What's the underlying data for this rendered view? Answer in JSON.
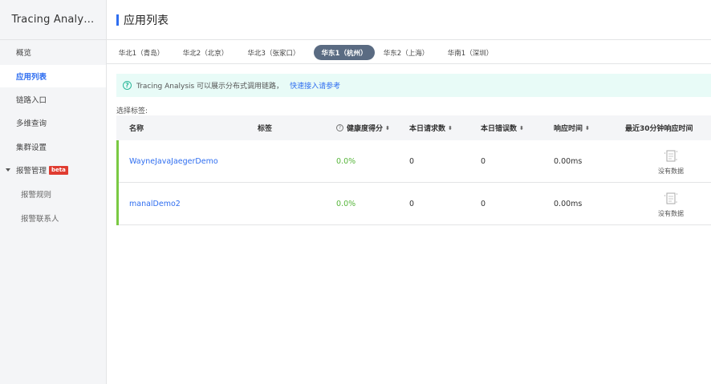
{
  "sidebar": {
    "brand": "Tracing Analy…",
    "items": [
      {
        "label": "概览"
      },
      {
        "label": "应用列表"
      },
      {
        "label": "链路入口"
      },
      {
        "label": "多维查询"
      },
      {
        "label": "集群设置"
      },
      {
        "label": "报警管理",
        "badge": "beta"
      },
      {
        "label": "报警规则"
      },
      {
        "label": "报警联系人"
      }
    ]
  },
  "header": {
    "title": "应用列表"
  },
  "regions": [
    {
      "label": "华北1（青岛）"
    },
    {
      "label": "华北2（北京）"
    },
    {
      "label": "华北3（张家口）"
    },
    {
      "label": "华东1（杭州）",
      "active": true
    },
    {
      "label": "华东2（上海）"
    },
    {
      "label": "华南1（深圳）"
    }
  ],
  "banner": {
    "text": "Tracing Analysis 可以展示分布式调用链路，",
    "link": "快速接入请参考"
  },
  "tag_label": "选择标签:",
  "table": {
    "columns": {
      "name": "名称",
      "tags": "标签",
      "health": "健康度得分",
      "requests": "本日请求数",
      "errors": "本日错误数",
      "response_time": "响应时间",
      "recent": "最近30分钟响应时间"
    },
    "rows": [
      {
        "name": "WayneJavaJaegerDemo",
        "tags": "",
        "health": "0.0%",
        "requests": "0",
        "errors": "0",
        "response_time": "0.00ms",
        "recent": "没有数据"
      },
      {
        "name": "manalDemo2",
        "tags": "",
        "health": "0.0%",
        "requests": "0",
        "errors": "0",
        "response_time": "0.00ms",
        "recent": "没有数据"
      }
    ]
  },
  "icons": {
    "help": "question-circle-icon",
    "sort": "sort-icon",
    "nodata": "no-data-document-icon",
    "caret": "caret-down-icon"
  },
  "colors": {
    "accent": "#2f6ef0",
    "active_tab": "#5a6b82",
    "health_green": "#56b53a",
    "banner_bg": "#e8fbf7",
    "beta_red": "#e03c31"
  }
}
